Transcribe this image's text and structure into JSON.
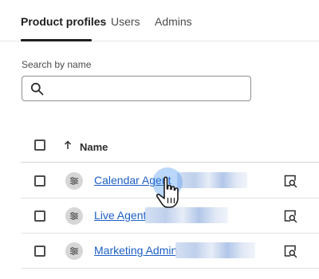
{
  "tabs": [
    {
      "label": "Product profiles",
      "active": true
    },
    {
      "label": "Users",
      "active": false
    },
    {
      "label": "Admins",
      "active": false
    }
  ],
  "search": {
    "label": "Search by name",
    "value": "",
    "placeholder": ""
  },
  "table": {
    "columns": [
      {
        "label": "Name",
        "sort": "ascending"
      }
    ],
    "rows": [
      {
        "name": "Calendar Agent"
      },
      {
        "name": "Live Agent"
      },
      {
        "name": "Marketing Admin"
      }
    ]
  },
  "colors": {
    "link": "#1d5fc4",
    "accent": "#1f1f1f",
    "highlight": "#3b8cf0"
  },
  "icons": [
    "search-icon",
    "sort-arrow-up-icon",
    "settings-sliders-icon",
    "view-details-icon",
    "hand-pointer-cursor-icon"
  ]
}
